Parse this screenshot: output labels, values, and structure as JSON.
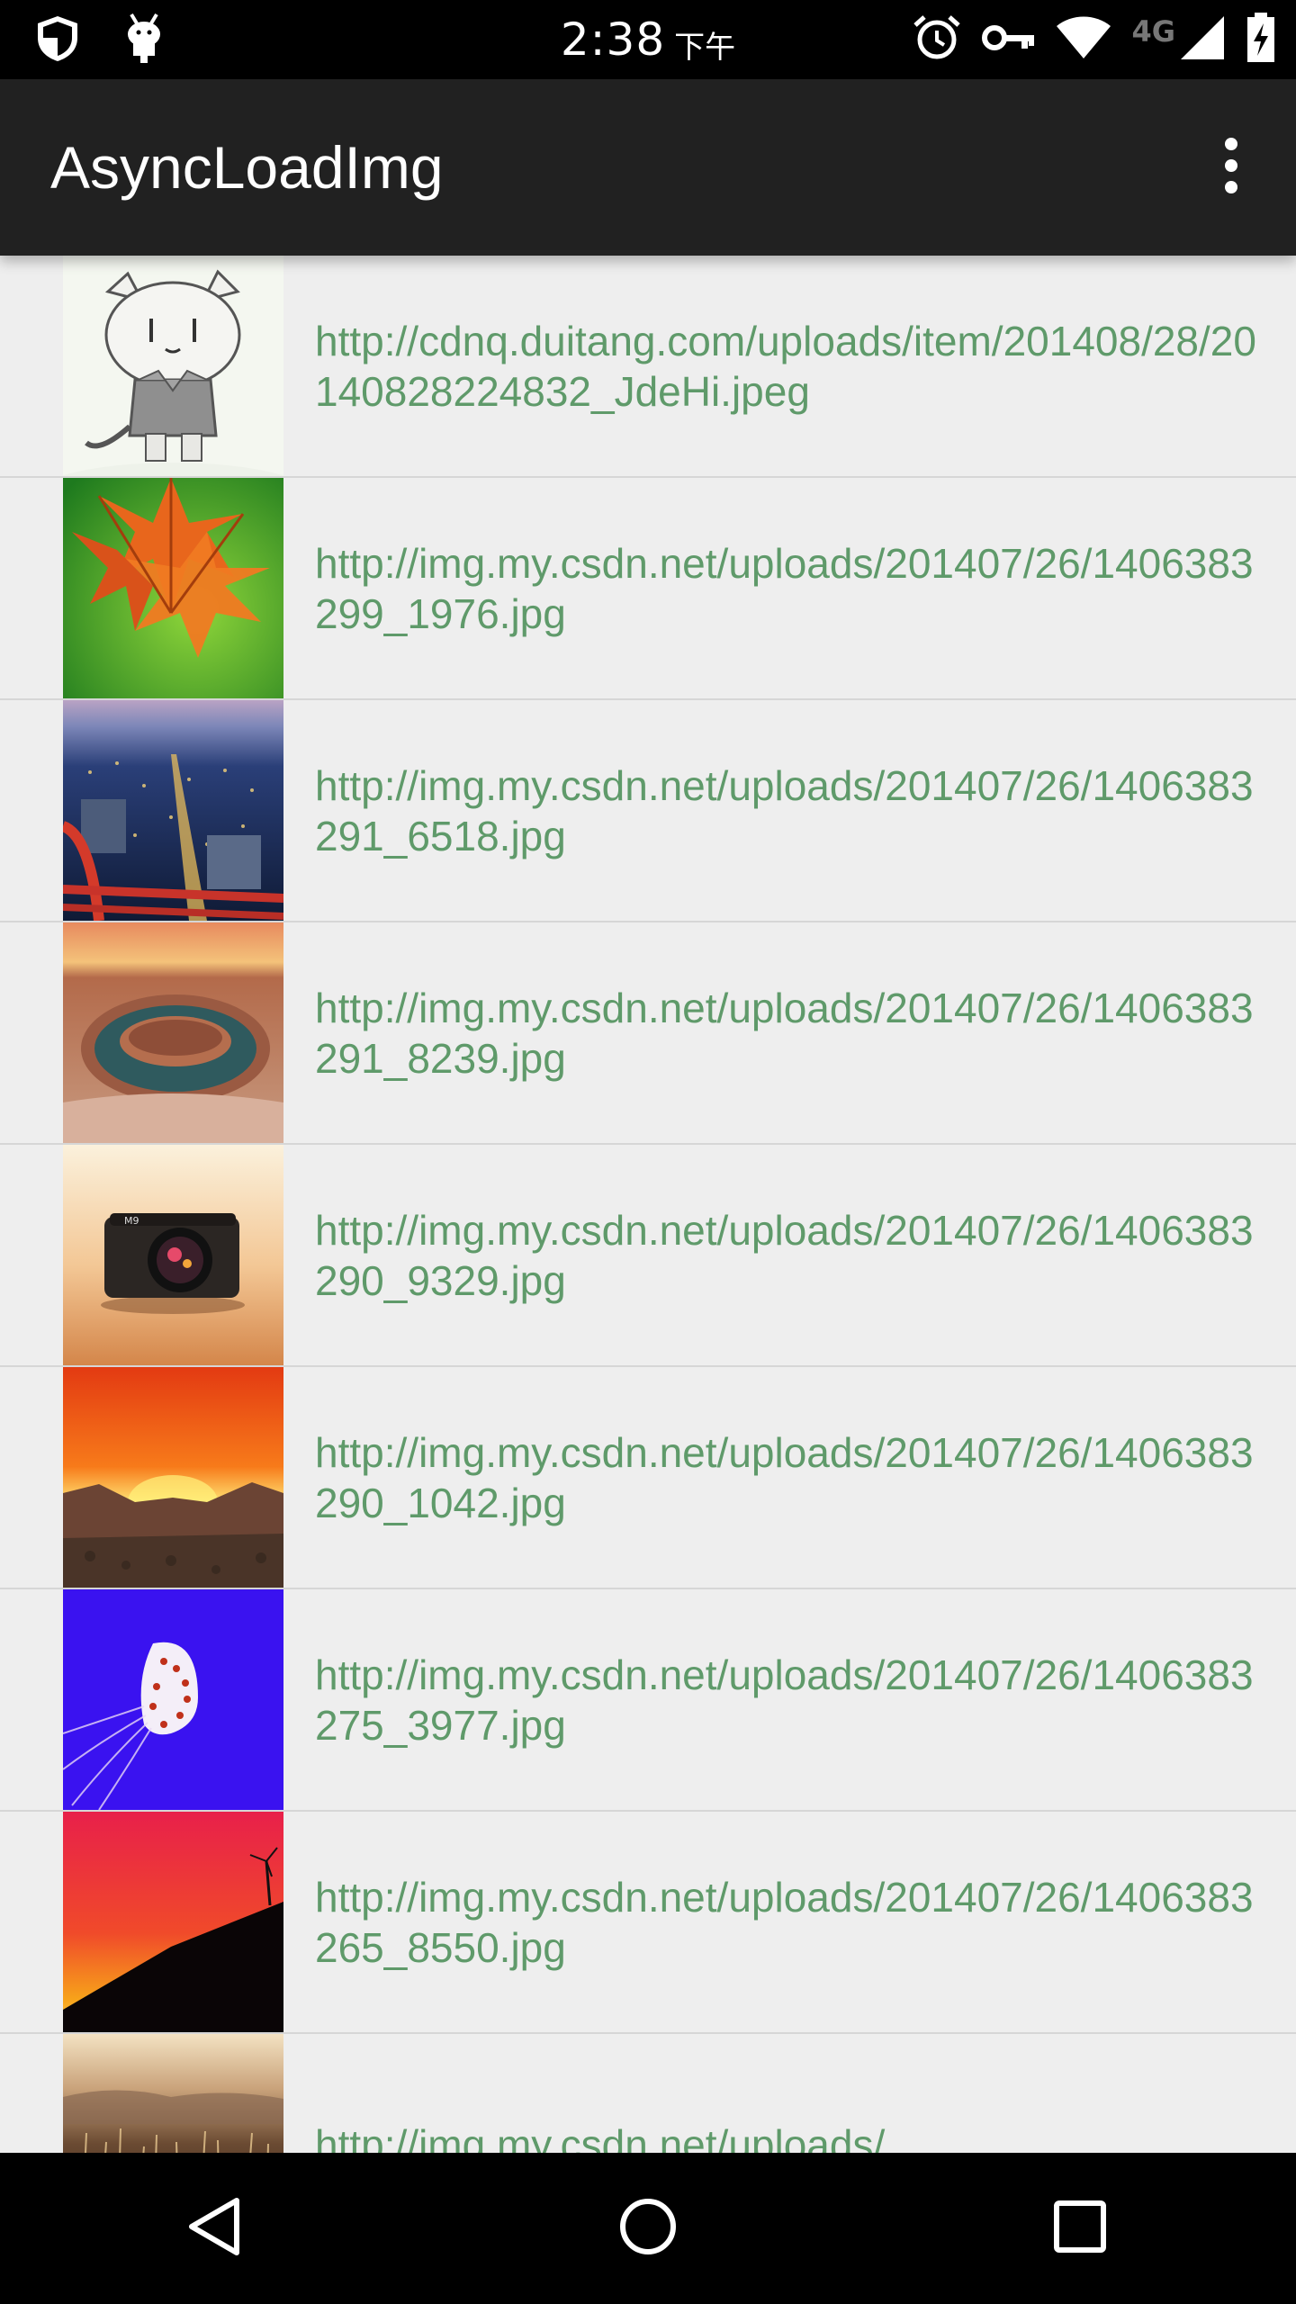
{
  "status_bar": {
    "time": "2:38",
    "ampm": "下午",
    "network_label": "4G",
    "icons": [
      "shield-icon",
      "android-debug-icon",
      "alarm-icon",
      "vpn-key-icon",
      "wifi-icon",
      "cell-signal-icon",
      "battery-charging-icon"
    ]
  },
  "app_bar": {
    "title": "AsyncLoadImg",
    "overflow_icon": "more-vert-icon"
  },
  "list": {
    "items": [
      {
        "url": "http://cdnq.duitang.com/uploads/item/201408/28/20140828224832_JdeHi.jpeg",
        "thumb": "cartoon-cat"
      },
      {
        "url": "http://img.my.csdn.net/uploads/201407/26/1406383299_1976.jpg",
        "thumb": "autumn-leaves"
      },
      {
        "url": "http://img.my.csdn.net/uploads/201407/26/1406383291_6518.jpg",
        "thumb": "city-night"
      },
      {
        "url": "http://img.my.csdn.net/uploads/201407/26/1406383291_8239.jpg",
        "thumb": "horseshoe-canyon"
      },
      {
        "url": "http://img.my.csdn.net/uploads/201407/26/1406383290_9329.jpg",
        "thumb": "camera"
      },
      {
        "url": "http://img.my.csdn.net/uploads/201407/26/1406383290_1042.jpg",
        "thumb": "mountain-sunset"
      },
      {
        "url": "http://img.my.csdn.net/uploads/201407/26/1406383275_3977.jpg",
        "thumb": "jellyfish"
      },
      {
        "url": "http://img.my.csdn.net/uploads/201407/26/1406383265_8550.jpg",
        "thumb": "red-sunset-hill"
      },
      {
        "url": "http://img.my.csdn.net/uploads/",
        "thumb": "grass-dusk"
      }
    ]
  },
  "nav_bar": {
    "buttons": [
      "back-icon",
      "home-icon",
      "recents-icon"
    ]
  },
  "colors": {
    "status_bar_bg": "#000000",
    "app_bar_bg": "#212121",
    "list_bg": "#eeeeee",
    "url_text": "#5f9a6a",
    "divider": "#d6d6d6"
  }
}
